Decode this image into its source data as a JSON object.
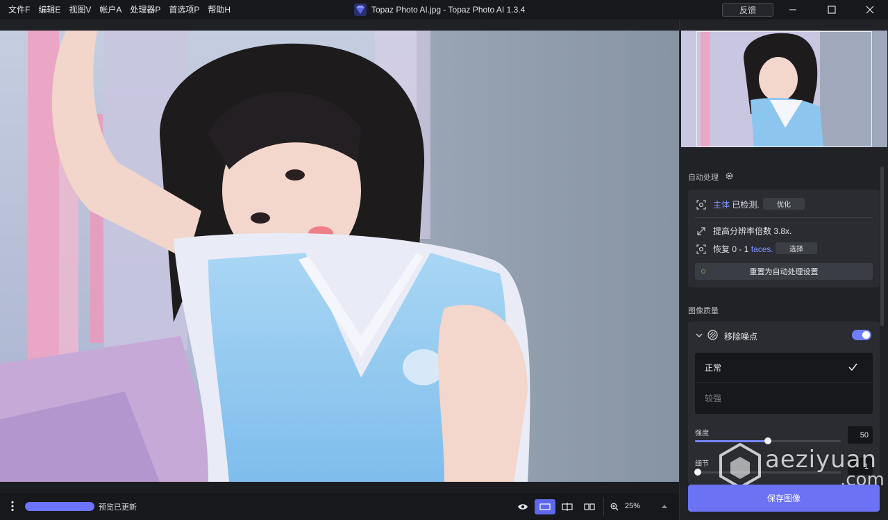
{
  "menu": [
    "文件F",
    "编辑E",
    "视图V",
    "帐户A",
    "处理器P",
    "首选项P",
    "帮助H"
  ],
  "window_title": "Topaz Photo AI.jpg - Topaz Photo AI 1.3.4",
  "feedback_label": "反馈",
  "autopilot": {
    "label": "自动处理",
    "subject_link": "主体",
    "subject_text": "已检测.",
    "refine_label": "优化",
    "upscale_text": "提高分辨率倍数 3.8x.",
    "recover_text": "恢复 0 - 1",
    "faces_link": "faces.",
    "select_label": "选择",
    "reset_label": "重置为自动处理设置"
  },
  "image_quality": {
    "label": "图像质量",
    "remove_noise_label": "移除噪点",
    "remove_noise_enabled": true,
    "options": [
      "正常",
      "较强"
    ],
    "selected_option": "正常",
    "strength_label": "强度",
    "strength_value": "50",
    "strength_fraction": 0.5,
    "detail_label": "细节",
    "detail_value": "1",
    "detail_fraction": 0.02
  },
  "save_label": "保存图像",
  "status": {
    "progress_fraction": 1.0,
    "text": "预览已更新"
  },
  "zoom": "25%",
  "watermark": {
    "text": "aeziyuan",
    "suffix": ".com"
  },
  "colors": {
    "accent": "#6b72f4",
    "link": "#7f92ff",
    "background": "#1b1d21"
  }
}
